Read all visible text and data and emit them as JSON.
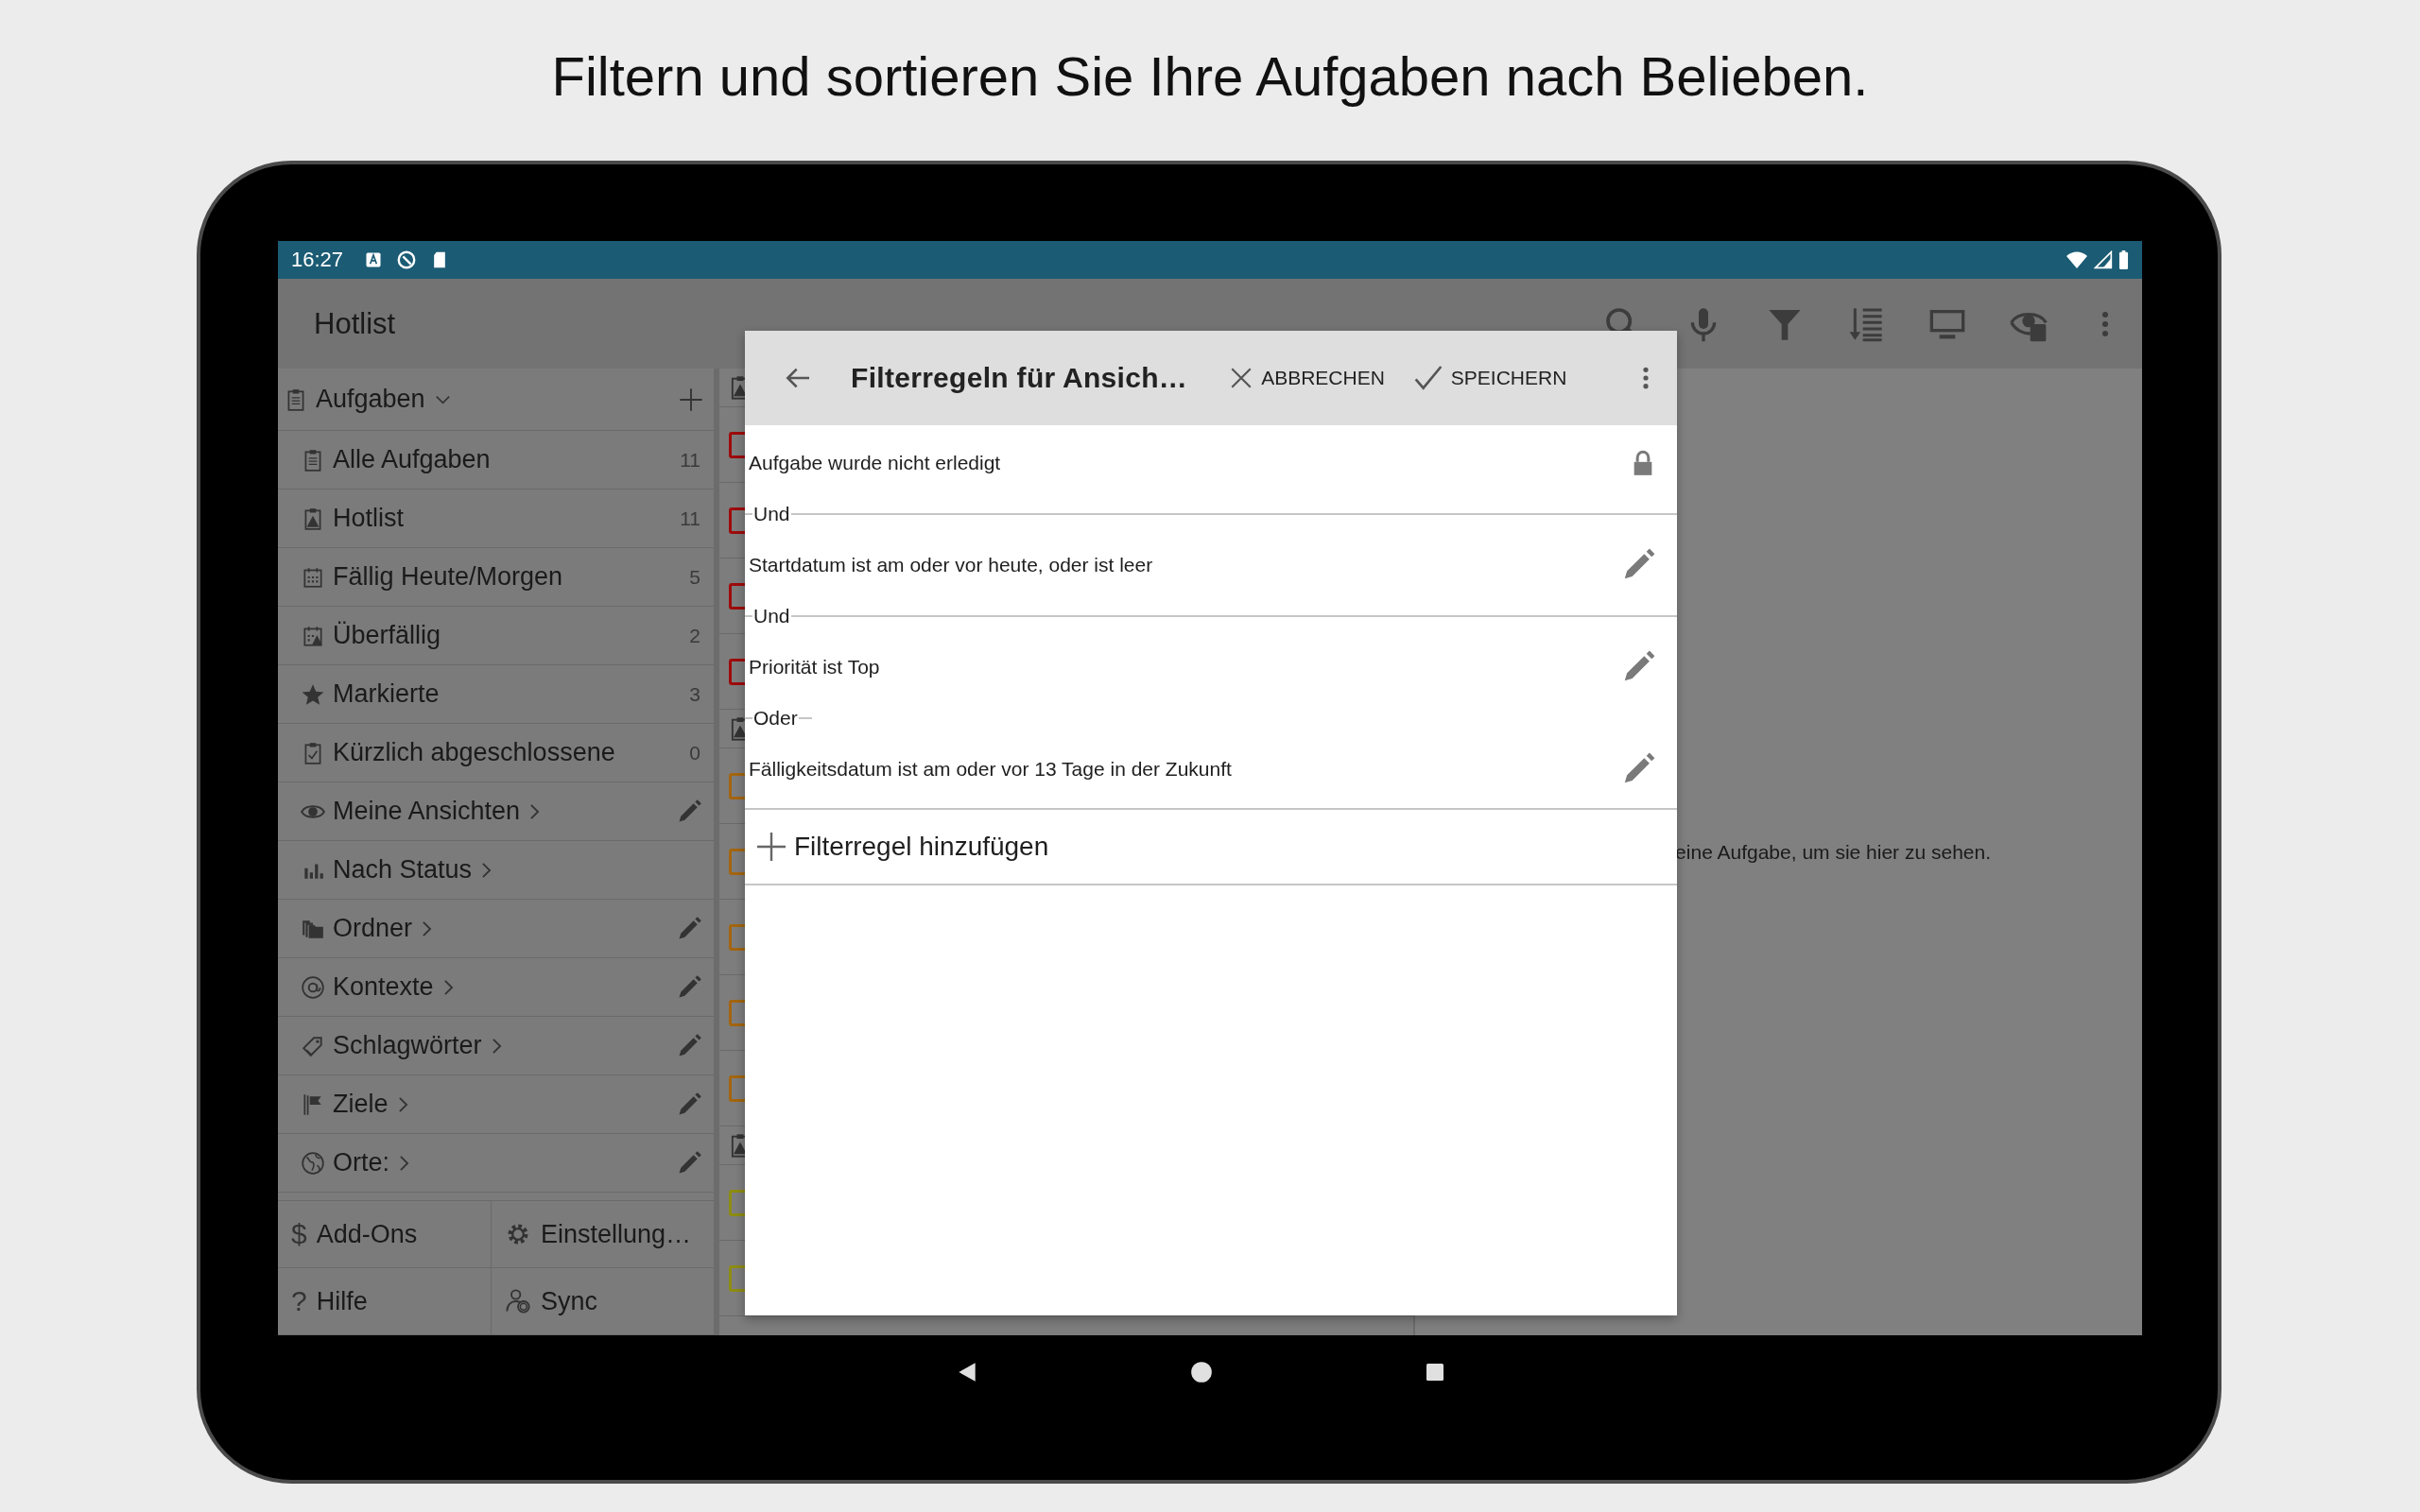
{
  "headline": "Filtern und sortieren Sie Ihre Aufgaben nach Belieben.",
  "status_bar": {
    "time": "16:27"
  },
  "toolbar": {
    "title": "Hotlist"
  },
  "sidebar": {
    "header": {
      "label": "Aufgaben",
      "expanded": true
    },
    "items": [
      {
        "label": "Alle Aufgaben",
        "count": "11",
        "submenu": false,
        "editable": false
      },
      {
        "label": "Hotlist",
        "count": "11",
        "submenu": false,
        "editable": false
      },
      {
        "label": "Fällig Heute/Morgen",
        "count": "5",
        "submenu": false,
        "editable": false
      },
      {
        "label": "Überfällig",
        "count": "2",
        "submenu": false,
        "editable": false
      },
      {
        "label": "Markierte",
        "count": "3",
        "submenu": false,
        "editable": false
      },
      {
        "label": "Kürzlich abgeschlossene",
        "count": "0",
        "submenu": false,
        "editable": false
      },
      {
        "label": "Meine Ansichten",
        "submenu": true,
        "editable": true
      },
      {
        "label": "Nach Status",
        "submenu": true,
        "editable": false
      },
      {
        "label": "Ordner",
        "submenu": true,
        "editable": true
      },
      {
        "label": "Kontexte",
        "submenu": true,
        "editable": true
      },
      {
        "label": "Schlagwörter",
        "submenu": true,
        "editable": true
      },
      {
        "label": "Ziele",
        "submenu": true,
        "editable": true
      },
      {
        "label": "Orte:",
        "submenu": true,
        "editable": true
      }
    ],
    "footer": [
      {
        "glyph": "$",
        "label": "Add-Ons"
      },
      {
        "label": "Einstellung…"
      },
      {
        "glyph": "?",
        "label": "Hilfe"
      },
      {
        "label": "Sync"
      }
    ]
  },
  "task_list": {
    "rows": [
      {
        "kind": "header"
      },
      {
        "kind": "task",
        "color": "#9e0b0b"
      },
      {
        "kind": "task",
        "color": "#9e0b0b"
      },
      {
        "kind": "task",
        "color": "#9e0b0b"
      },
      {
        "kind": "task",
        "color": "#9e0b0b"
      },
      {
        "kind": "header"
      },
      {
        "kind": "task",
        "color": "#a3650f"
      },
      {
        "kind": "task",
        "color": "#a3650f"
      },
      {
        "kind": "task",
        "color": "#a3650f"
      },
      {
        "kind": "task",
        "color": "#a3650f"
      },
      {
        "kind": "task",
        "color": "#a3650f"
      },
      {
        "kind": "header"
      },
      {
        "kind": "task",
        "color": "#8d8c12"
      },
      {
        "kind": "task",
        "color": "#8d8c12"
      }
    ]
  },
  "detail": {
    "message": "eine Aufgabe, um sie hier zu sehen."
  },
  "dialog": {
    "title": "Filterregeln für Ansich…",
    "cancel": "ABBRECHEN",
    "save": "SPEICHERN",
    "rules": [
      {
        "text": "Aufgabe wurde nicht erledigt",
        "locked": true,
        "connector": {
          "label": "Und",
          "full_line": true
        }
      },
      {
        "text": "Startdatum ist am oder vor heute, oder ist leer",
        "locked": false,
        "connector": {
          "label": "Und",
          "full_line": true
        }
      },
      {
        "text": "Priorität ist Top",
        "locked": false,
        "connector": {
          "label": "Oder",
          "full_line": false
        }
      },
      {
        "text": "Fälligkeitsdatum ist am oder vor 13 Tage in der Zukunft",
        "locked": false
      }
    ],
    "add": "Filterregel hinzufügen"
  }
}
